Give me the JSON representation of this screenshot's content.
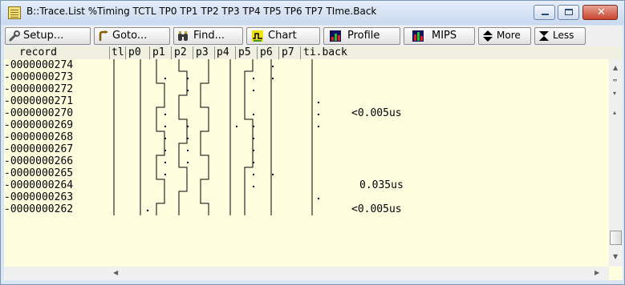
{
  "window": {
    "title": "B::Trace.List %Timing TCTL TP0 TP1 TP2 TP3 TP4 TP5 TP6 TP7 TIme.Back",
    "buttons": [
      "minimize",
      "maximize",
      "close"
    ]
  },
  "toolbar": {
    "setup_label": "Setup...",
    "goto_label": "Goto...",
    "find_label": "Find...",
    "chart_label": "Chart",
    "profile_label": "Profile",
    "mips_label": "MIPS",
    "more_label": "More",
    "less_label": "Less"
  },
  "columns": {
    "record": "record",
    "tl": "tl",
    "p0": "p0",
    "p1": "p1",
    "p2": "p2",
    "p3": "p3",
    "p4": "p4",
    "p5": "p5",
    "p6": "p6",
    "p7": "p7",
    "tiback": "ti.back"
  },
  "rows": [
    {
      "record": "-0000000274",
      "tiback": ""
    },
    {
      "record": "-0000000273",
      "tiback": ""
    },
    {
      "record": "-0000000272",
      "tiback": ""
    },
    {
      "record": "-0000000271",
      "tiback": ""
    },
    {
      "record": "-0000000270",
      "tiback": "<0.005us"
    },
    {
      "record": "-0000000269",
      "tiback": ""
    },
    {
      "record": "-0000000268",
      "tiback": ""
    },
    {
      "record": "-0000000267",
      "tiback": ""
    },
    {
      "record": "-0000000266",
      "tiback": ""
    },
    {
      "record": "-0000000265",
      "tiback": ""
    },
    {
      "record": "-0000000264",
      "tiback": "0.035us"
    },
    {
      "record": "-0000000263",
      "tiback": ""
    },
    {
      "record": "-0000000262",
      "tiback": "<0.005us"
    }
  ],
  "waveforms": {
    "tl": [
      0,
      0,
      0,
      0,
      0,
      0,
      0,
      0,
      0,
      0,
      0,
      0,
      0
    ],
    "p0": [
      0,
      0,
      0,
      0,
      0,
      0,
      0,
      0,
      0,
      0,
      0,
      0,
      0
    ],
    "p1": [
      0,
      0,
      1,
      1,
      0,
      0,
      1,
      1,
      0,
      0,
      1,
      1,
      0
    ],
    "p2": [
      0,
      1,
      1,
      0,
      0,
      1,
      1,
      0,
      0,
      1,
      1,
      0,
      0
    ],
    "p3": [
      1,
      1,
      0,
      0,
      1,
      1,
      0,
      0,
      1,
      1,
      0,
      0,
      1
    ],
    "p4": [
      0,
      0,
      0,
      0,
      0,
      0,
      0,
      0,
      0,
      0,
      0,
      0,
      0
    ],
    "p5": [
      1,
      0,
      0,
      0,
      0,
      1,
      1,
      1,
      1,
      0,
      0,
      0,
      0
    ],
    "p6": [
      1,
      1,
      1,
      1,
      1,
      1,
      1,
      1,
      1,
      1,
      1,
      1,
      1
    ],
    "p7": [
      0,
      0,
      0,
      0,
      0,
      0,
      0,
      0,
      0,
      0,
      0,
      0,
      0
    ]
  },
  "icons": {
    "setup": "wrench-icon",
    "goto": "goto-arrow-icon",
    "find": "binoculars-icon",
    "chart": "chart-icon",
    "profile": "profile-icon",
    "mips": "mips-icon",
    "more": "up-down-arrows-icon",
    "less": "hourglass-icon"
  }
}
